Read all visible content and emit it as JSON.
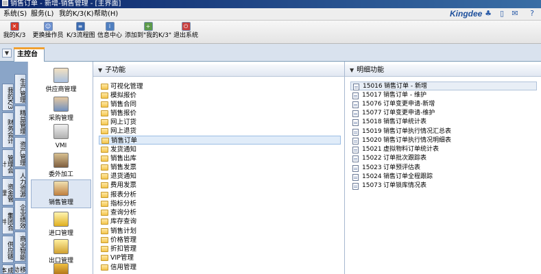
{
  "window": {
    "title": "销售订单 - 新增-销售管理 - [主界面]"
  },
  "menubar": {
    "items": [
      {
        "label": "系统(S)"
      },
      {
        "label": "服务(L)"
      },
      {
        "label": "我的K/3(K)"
      },
      {
        "label": "帮助(H)"
      }
    ],
    "brand": "Kingdee"
  },
  "toolbar": {
    "items": [
      {
        "label": "我的K/3",
        "icon": "red-x-icon"
      },
      {
        "label": "更换操作员",
        "icon": "users-icon"
      },
      {
        "label": "K/3流程图",
        "icon": "flowchart-icon"
      },
      {
        "label": "信息中心",
        "icon": "info-center-icon"
      },
      {
        "label": "添加到\"我的K/3\"",
        "icon": "add-favorite-icon"
      },
      {
        "label": "退出系统",
        "icon": "exit-icon"
      }
    ]
  },
  "tab": {
    "label": "主控台"
  },
  "vertical_nav": {
    "items": [
      {
        "label": "我的K/3"
      },
      {
        "label": "财务会计"
      },
      {
        "label": "管理会计"
      },
      {
        "label": "资金管理"
      },
      {
        "label": "集团合并"
      },
      {
        "label": "供应链"
      },
      {
        "label": "成本"
      },
      {
        "label": "生产管理"
      },
      {
        "label": "精益管理"
      },
      {
        "label": "资产管理"
      },
      {
        "label": "人力资源"
      },
      {
        "label": "企业绩效"
      },
      {
        "label": "商业智能"
      },
      {
        "label": "移动"
      }
    ]
  },
  "modules": {
    "items": [
      {
        "label": "供应商管理",
        "icon": "supplier-icon",
        "active": false
      },
      {
        "label": "采购管理",
        "icon": "purchase-icon",
        "active": false
      },
      {
        "label": "VMI",
        "icon": "vmi-icon",
        "active": false
      },
      {
        "label": "委外加工",
        "icon": "outsourcing-icon",
        "active": false
      },
      {
        "label": "销售管理",
        "icon": "sales-icon",
        "active": true
      },
      {
        "label": "进口管理",
        "icon": "import-icon",
        "active": false
      },
      {
        "label": "出口管理",
        "icon": "export-icon",
        "active": false
      }
    ]
  },
  "subfunctions": {
    "title": "子功能",
    "items": [
      {
        "label": "可视化管理"
      },
      {
        "label": "模拟报价"
      },
      {
        "label": "销售合同"
      },
      {
        "label": "销售报价"
      },
      {
        "label": "网上订货"
      },
      {
        "label": "网上退货"
      },
      {
        "label": "销售订单",
        "selected": true
      },
      {
        "label": "发货通知"
      },
      {
        "label": "销售出库"
      },
      {
        "label": "销售发票"
      },
      {
        "label": "退货通知"
      },
      {
        "label": "费用发票"
      },
      {
        "label": "报表分析"
      },
      {
        "label": "指标分析"
      },
      {
        "label": "查询分析"
      },
      {
        "label": "库存查询"
      },
      {
        "label": "销售计划"
      },
      {
        "label": "价格管理"
      },
      {
        "label": "折扣管理"
      },
      {
        "label": "VIP管理"
      },
      {
        "label": "信用管理"
      }
    ]
  },
  "details": {
    "title": "明细功能",
    "items": [
      {
        "code": "15016",
        "label": "销售订单 - 新增",
        "selected": true
      },
      {
        "code": "15017",
        "label": "销售订单 - 维护"
      },
      {
        "code": "15076",
        "label": "订单变更申请-新增"
      },
      {
        "code": "15077",
        "label": "订单变更申请-维护"
      },
      {
        "code": "15018",
        "label": "销售订单统计表"
      },
      {
        "code": "15019",
        "label": "销售订单执行情况汇总表"
      },
      {
        "code": "15020",
        "label": "销售订单执行情况明细表"
      },
      {
        "code": "15021",
        "label": "虚拟物料订单统计表"
      },
      {
        "code": "15022",
        "label": "订单批次跟踪表"
      },
      {
        "code": "15023",
        "label": "订单预评估表"
      },
      {
        "code": "15024",
        "label": "销售订单全程跟踪"
      },
      {
        "code": "15073",
        "label": "订单锁库情况表"
      }
    ]
  },
  "colors": {
    "titlebar": "#0a246a",
    "nav_blue": "#8aa5c8",
    "tab_accent": "#f0a030",
    "folder": "#f4c64d",
    "selection": "#e0ecf9"
  }
}
